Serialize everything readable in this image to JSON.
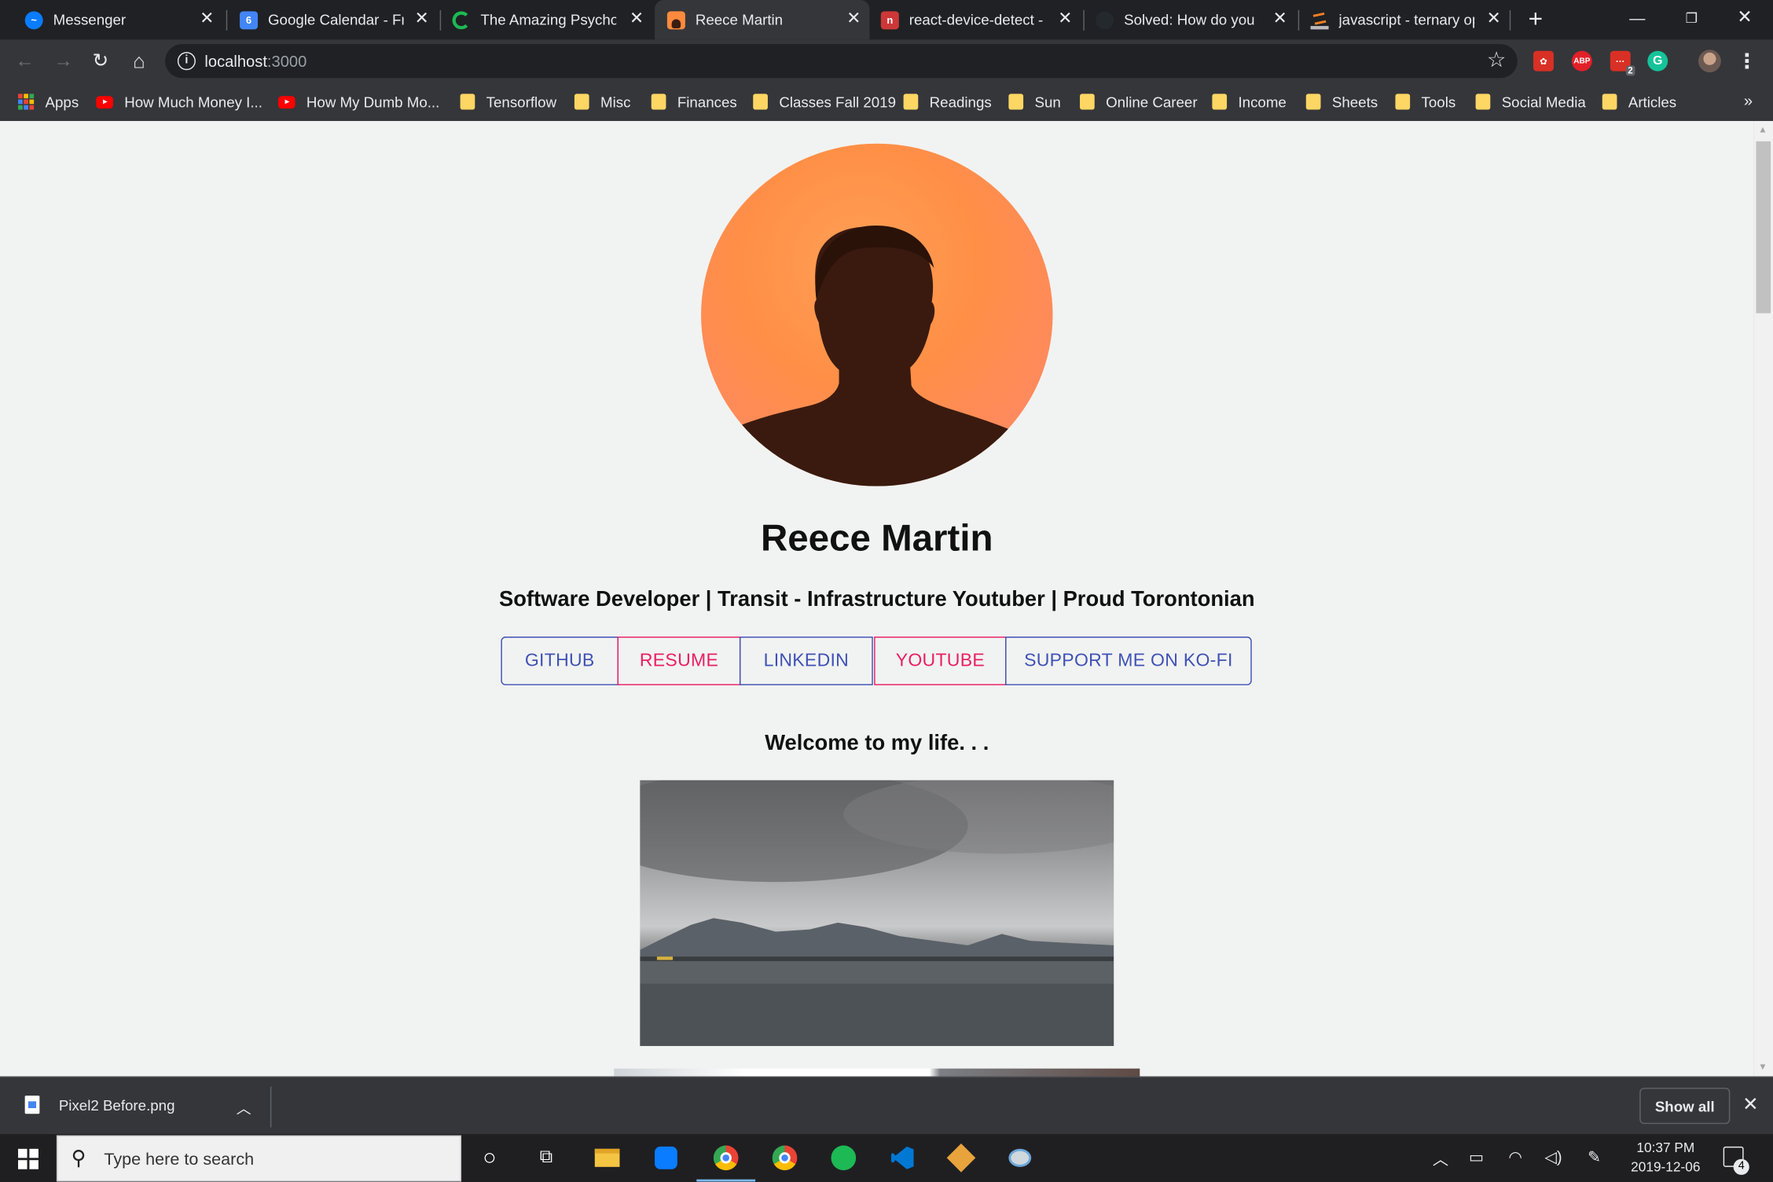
{
  "browser": {
    "tabs": [
      {
        "title": "Messenger",
        "icon": "messenger-icon",
        "color": "#0a7cff"
      },
      {
        "title": "Google Calendar - Frid",
        "icon": "calendar-icon",
        "color": "#4285f4",
        "badge": "6"
      },
      {
        "title": "The Amazing Psycholo",
        "icon": "loading-spinner-icon",
        "color": "#1db954"
      },
      {
        "title": "Reece Martin",
        "icon": "profile-favicon-icon",
        "color": "#ff8a3d"
      },
      {
        "title": "react-device-detect - n",
        "icon": "npm-icon",
        "color": "#cb3837"
      },
      {
        "title": "Solved: How do you p",
        "icon": "github-icon",
        "color": "#24292e"
      },
      {
        "title": "javascript - ternary op",
        "icon": "stackoverflow-icon",
        "color": "#f48024"
      }
    ],
    "active_tab_index": 3,
    "address": {
      "host": "localhost",
      "port": ":3000"
    },
    "extensions": [
      {
        "name": "extension-red-icon",
        "label": "",
        "color": "#d93025"
      },
      {
        "name": "adblock-plus-icon",
        "label": "ABP",
        "color": "#e22027"
      },
      {
        "name": "extension-badge-icon",
        "label": "2",
        "color": "#d93025"
      },
      {
        "name": "grammarly-icon",
        "label": "G",
        "color": "#15c39a"
      }
    ],
    "bookmarks": [
      {
        "label": "Apps",
        "icon": "apps-icon"
      },
      {
        "label": "How Much Money I...",
        "icon": "youtube-icon"
      },
      {
        "label": "How My Dumb Mo...",
        "icon": "youtube-icon"
      },
      {
        "label": "Tensorflow",
        "icon": "folder-icon"
      },
      {
        "label": "Misc",
        "icon": "folder-icon"
      },
      {
        "label": "Finances",
        "icon": "folder-icon"
      },
      {
        "label": "Classes Fall 2019",
        "icon": "folder-icon"
      },
      {
        "label": "Readings",
        "icon": "folder-icon"
      },
      {
        "label": "Sun",
        "icon": "folder-icon"
      },
      {
        "label": "Online Career",
        "icon": "folder-icon"
      },
      {
        "label": "Income",
        "icon": "folder-icon"
      },
      {
        "label": "Sheets",
        "icon": "folder-icon"
      },
      {
        "label": "Tools",
        "icon": "folder-icon"
      },
      {
        "label": "Social Media",
        "icon": "folder-icon"
      },
      {
        "label": "Articles",
        "icon": "folder-icon"
      }
    ]
  },
  "page": {
    "name": "Reece Martin",
    "tagline": "Software Developer | Transit - Infrastructure Youtuber | Proud Torontonian",
    "links": [
      {
        "label": "GITHUB",
        "color": "#3f51b5"
      },
      {
        "label": "RESUME",
        "color": "#e91e63"
      },
      {
        "label": "LINKEDIN",
        "color": "#3f51b5"
      },
      {
        "label": "YOUTUBE",
        "color": "#e91e63"
      },
      {
        "label": "SUPPORT ME ON KO-FI",
        "color": "#3f51b5"
      }
    ],
    "welcome": "Welcome to my life. . ."
  },
  "downloads": {
    "file": "Pixel2 Before.png",
    "show_all": "Show all"
  },
  "taskbar": {
    "search_placeholder": "Type here to search",
    "time": "10:37 PM",
    "date": "2019-12-06",
    "notifications": "4"
  }
}
